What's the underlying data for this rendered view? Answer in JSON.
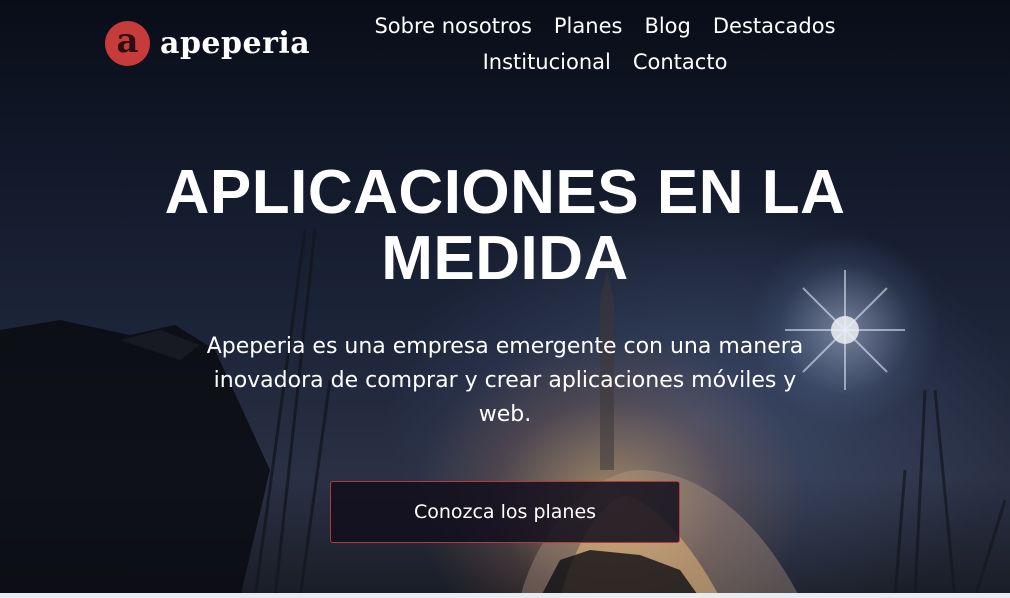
{
  "brand": {
    "logo_letter": "a",
    "name": "apeperia",
    "accent_color": "#c73b3b"
  },
  "nav": {
    "items": [
      {
        "label": "Sobre nosotros"
      },
      {
        "label": "Planes"
      },
      {
        "label": "Blog"
      },
      {
        "label": "Destacados"
      },
      {
        "label": "Institucional"
      },
      {
        "label": "Contacto"
      }
    ]
  },
  "hero": {
    "title": "APLICACIONES EN LA MEDIDA",
    "subtitle": "Apeperia es una empresa emergente con una manera inovadora de comprar y crear aplicaciones móviles y web.",
    "cta_label": "Conozca los planes",
    "background_image": "rocket-launch-photo"
  }
}
